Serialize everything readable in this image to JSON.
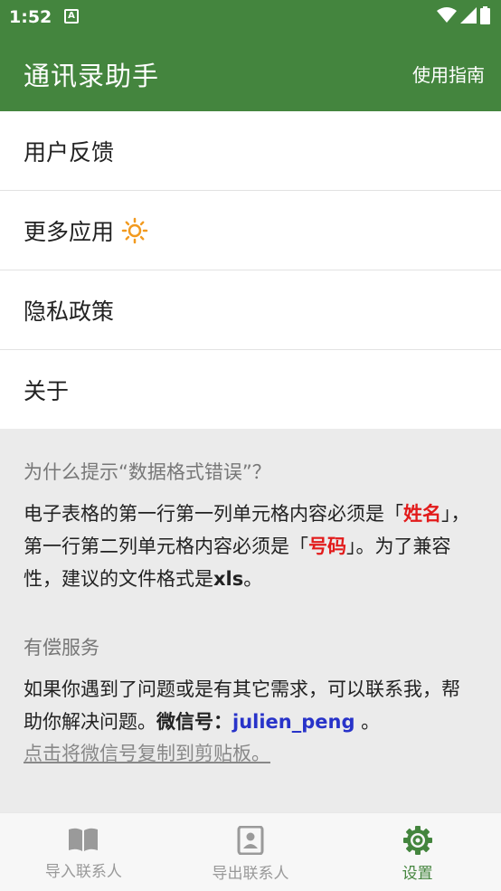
{
  "status_bar": {
    "time": "1:52",
    "notification_glyph": "A"
  },
  "app_bar": {
    "title": "通讯录助手",
    "guide_label": "使用指南"
  },
  "menu": {
    "items": [
      {
        "label": "用户反馈"
      },
      {
        "label": "更多应用",
        "icon": "sun-icon"
      },
      {
        "label": "隐私政策"
      },
      {
        "label": "关于"
      }
    ]
  },
  "info": {
    "q1": {
      "heading": "为什么提示“数据格式错误”？",
      "p1": "电子表格的第一行第一列单元格内容必须是「",
      "red1": "姓名",
      "p2": "」，第一行第二列单元格内容必须是「",
      "red2": "号码",
      "p3": "」。为了兼容性，建议的文件格式是",
      "bold1": "xls",
      "p4": "。"
    },
    "q2": {
      "heading": "有偿服务",
      "p1": "如果你遇到了问题或是有其它需求，可以联系我，帮助你解决问题。",
      "wechat_label": "微信号：",
      "wechat_id": "julien_peng",
      "p2": " 。",
      "copy_link": "点击将微信号复制到剪贴板。"
    }
  },
  "bottom_nav": {
    "items": [
      {
        "label": "导入联系人",
        "icon": "book-icon",
        "active": false
      },
      {
        "label": "导出联系人",
        "icon": "contacts-icon",
        "active": false
      },
      {
        "label": "设置",
        "icon": "gear-icon",
        "active": true
      }
    ]
  },
  "colors": {
    "primary": "#44853e",
    "highlight_red": "#e21b1b",
    "link_blue": "#2833c9"
  }
}
